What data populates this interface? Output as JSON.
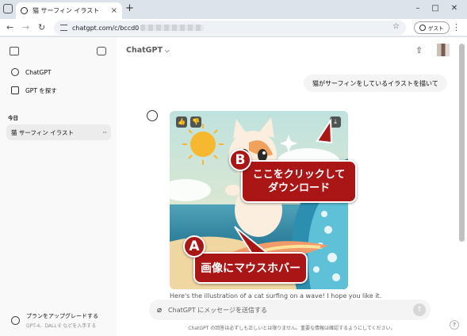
{
  "browser": {
    "tab_title": "猫 サーフィン イラスト",
    "tab_close": "×",
    "new_tab": "+",
    "url_visible": "chatgpt.com/c/bccd0",
    "guest_label": "ゲスト",
    "win_min": "–",
    "win_max": "□",
    "win_close": "✕",
    "back": "←",
    "forward": "→",
    "reload": "↻",
    "star": "☆",
    "menu": "⋮"
  },
  "sidebar": {
    "items": [
      {
        "label": "ChatGPT",
        "icon": "openai-logo-icon"
      },
      {
        "label": "GPT を探す",
        "icon": "grid-icon"
      }
    ],
    "date_heading": "今日",
    "chats": [
      {
        "label": "猫 サーフィン イラスト",
        "more": "···"
      }
    ],
    "upgrade_title": "プランをアップグレードする",
    "upgrade_sub": "GPT-4、DALL·E などを入手する"
  },
  "main": {
    "model_label": "ChatGPT",
    "model_chevron": "⌵",
    "share_icon": "⇧",
    "user_message": "猫がサーフィンをしているイラストを描いて",
    "assistant_partial": "Here's the illustration of a cat surfing on a wave! I hope you like it.",
    "image_actions": {
      "like": "👍",
      "dislike": "👎",
      "download": "⤓"
    },
    "composer_placeholder": "ChatGPT にメッセージを送信する",
    "composer_clip": "⌀",
    "send_icon": "↑",
    "footer": "ChatGPT の回答は必ずしも正しいとは限りません。重要な情報は確認するようにしてください。",
    "help": "?"
  },
  "callouts": {
    "a_badge": "A",
    "a_text": "画像にマウスホバー",
    "b_badge": "B",
    "b_line1": "ここをクリックして",
    "b_line2": "ダウンロード"
  },
  "colors": {
    "callout_red": "#aa1515",
    "sidebar_bg": "#f9f9f9",
    "chrome_bg": "#dde3ea"
  }
}
